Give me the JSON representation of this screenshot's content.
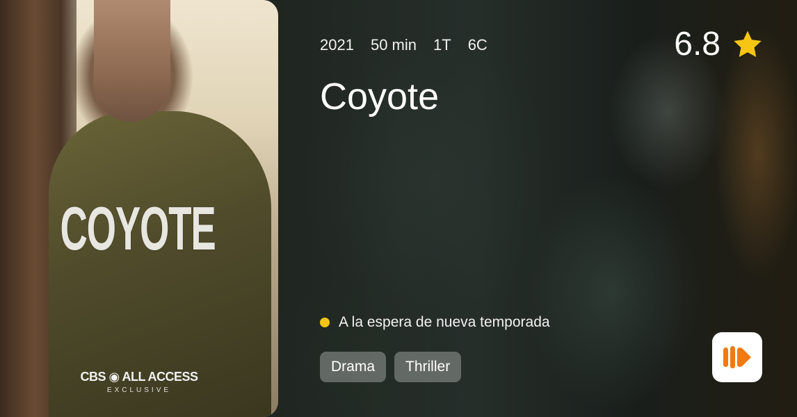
{
  "poster": {
    "title": "COYOTE",
    "network": "CBS ◉ ALL ACCESS",
    "network_sub": "EXCLUSIVE"
  },
  "meta": {
    "year": "2021",
    "duration": "50 min",
    "seasons": "1T",
    "episodes": "6C"
  },
  "rating": {
    "score": "6.8",
    "icon": "star-icon",
    "star_color": "#f7c614"
  },
  "title": "Coyote",
  "status": {
    "text": "A la espera de nueva temporada",
    "dot_color": "#f2c618"
  },
  "genres": [
    "Drama",
    "Thriller"
  ],
  "app_icon": {
    "icon": "play-logo-icon",
    "color": "#f07a14"
  }
}
